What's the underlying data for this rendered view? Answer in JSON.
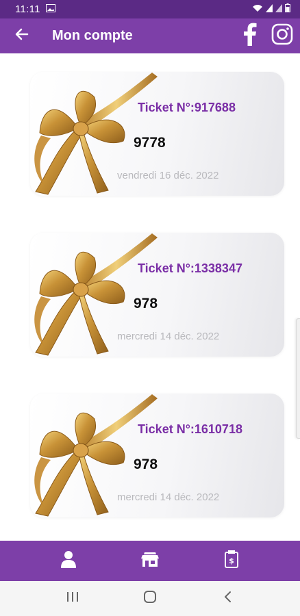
{
  "status_bar": {
    "time": "11:11",
    "icons": [
      "image-icon",
      "wifi-icon",
      "signal-icon",
      "signal-icon",
      "battery-icon"
    ]
  },
  "app_bar": {
    "title": "Mon compte",
    "back_icon": "arrow-left-icon",
    "social_icons": [
      "facebook-icon",
      "instagram-icon"
    ]
  },
  "tickets": [
    {
      "title": "Ticket N°:917688",
      "amount": "9778",
      "date": "vendredi 16 déc. 2022"
    },
    {
      "title": "Ticket N°:1338347",
      "amount": "978",
      "date": "mercredi 14 déc. 2022"
    },
    {
      "title": "Ticket N°:1610718",
      "amount": "978",
      "date": "mercredi 14 déc. 2022"
    }
  ],
  "bottom_nav": {
    "items": [
      "user-icon",
      "store-icon",
      "coupon-icon"
    ]
  },
  "system_nav": {
    "items": [
      "recents-icon",
      "home-icon",
      "back-icon"
    ]
  },
  "colors": {
    "status_bar": "#5b2a85",
    "app_bar": "#7d3fa8",
    "ticket_title": "#7a2ea6",
    "date": "#b9b9bd"
  }
}
